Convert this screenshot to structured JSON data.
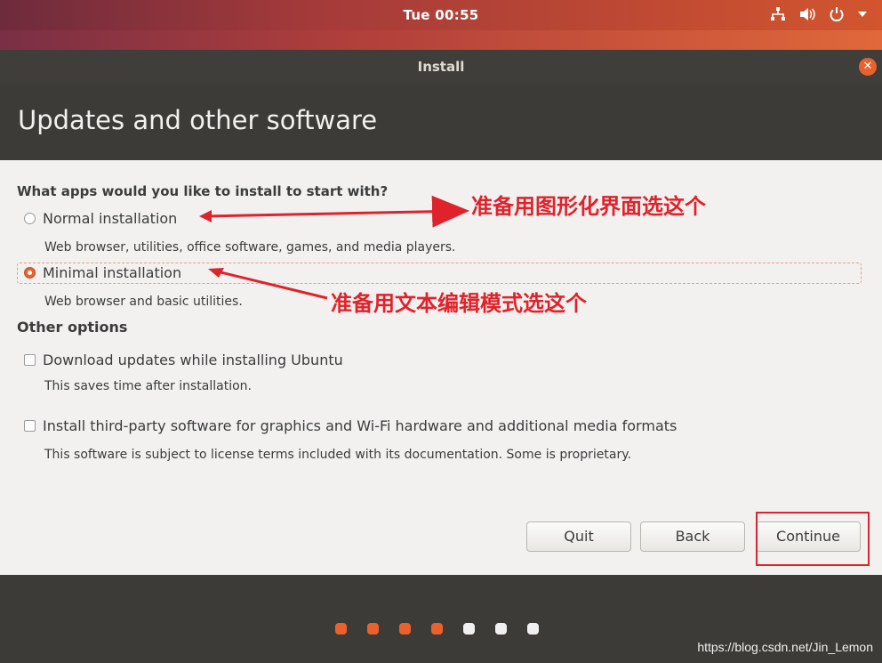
{
  "topbar": {
    "clock": "Tue 00:55"
  },
  "window": {
    "title": "Install"
  },
  "header": {
    "title": "Updates and other software"
  },
  "question": "What apps would you like to install to start with?",
  "options": [
    {
      "label": "Normal installation",
      "desc": "Web browser, utilities, office software, games, and media players.",
      "selected": false
    },
    {
      "label": "Minimal installation",
      "desc": "Web browser and basic utilities.",
      "selected": true
    }
  ],
  "other": {
    "heading": "Other options",
    "items": [
      {
        "label": "Download updates while installing Ubuntu",
        "desc": "This saves time after installation.",
        "checked": false
      },
      {
        "label": "Install third-party software for graphics and Wi-Fi hardware and additional media formats",
        "desc": "This software is subject to license terms included with its documentation. Some is proprietary.",
        "checked": false
      }
    ]
  },
  "buttons": {
    "quit": "Quit",
    "back": "Back",
    "continue": "Continue"
  },
  "annotations": {
    "normal": "准备用图形化界面选这个",
    "minimal": "准备用文本编辑模式选这个"
  },
  "progress": {
    "completed": 4,
    "total": 7,
    "done_color": "#e9622d",
    "todo_color": "#f0f0f0"
  },
  "watermark": "https://blog.csdn.net/Jin_Lemon"
}
